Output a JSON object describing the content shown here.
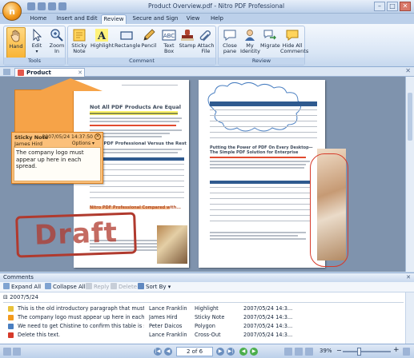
{
  "window": {
    "title": "Product Overview.pdf - Nitro PDF Professional",
    "controls": [
      "–",
      "□",
      "✕"
    ]
  },
  "ribbon_tabs": [
    {
      "label": "Home",
      "active": false
    },
    {
      "label": "Insert and Edit",
      "active": false
    },
    {
      "label": "Review",
      "active": true
    },
    {
      "label": "Secure and Sign",
      "active": false
    },
    {
      "label": "View",
      "active": false
    },
    {
      "label": "Help",
      "active": false
    }
  ],
  "ribbon": {
    "tools_group": "Tools",
    "comment_group": "Comment",
    "review_group": "Review",
    "buttons": {
      "hand": "Hand",
      "edit": "Edit",
      "zoom_in": "Zoom In",
      "sticky_note": "Sticky Note",
      "highlight": "Highlight",
      "rectangle": "Rectangle",
      "pencil": "Pencil",
      "text_box": "Text Box",
      "stamp": "Stamp",
      "attach_file": "Attach File",
      "close_pane": "Close pane",
      "my_identity": "My Identity",
      "migrate": "Migrate",
      "hide_all_comments": "Hide All Comments"
    }
  },
  "document_tab": {
    "label": "Product Overview.pdf"
  },
  "page_left": {
    "heading": "Not All PDF Products Are Equal",
    "subheading": "Nitro PDF Professional Versus the Rest",
    "subheading2": "Nitro PDF Professional Compared with..."
  },
  "page_right": {
    "heading": "Putting the Power of PDF On Every Desktop—The Simple PDF Solution for Enterprise"
  },
  "sticky_note": {
    "title": "Sticky Note",
    "date": "2007/05/24 14:37:50",
    "author": "James Hird",
    "options": "Options ▾",
    "text": "The company logo must appear up here in each spread."
  },
  "stamp": {
    "text": "Draft"
  },
  "comments": {
    "panel_title": "Comments",
    "toolbar": {
      "expand_all": "Expand All",
      "collapse_all": "Collapse All",
      "reply": "Reply",
      "delete": "Delete",
      "sort_by": "Sort By ▾"
    },
    "group_date": "2007/5/24",
    "rows": [
      {
        "text": "This is the old introductory paragraph that must be repl...",
        "author": "Lance Franklin",
        "type": "Highlight",
        "date": "2007/05/24 14:3...",
        "color": "#e8c23a",
        "selected": false
      },
      {
        "text": "The company logo must appear up here in each spre...",
        "author": "James Hird",
        "type": "Sticky Note",
        "date": "2007/05/24 14:3...",
        "color": "#f39a1d",
        "selected": false
      },
      {
        "text": "We need to get Chistine to confirm this table is still ac...",
        "author": "Peter Daicos",
        "type": "Polygon",
        "date": "2007/05/24 14:3...",
        "color": "#4a7fc1",
        "selected": false
      },
      {
        "text": "Delete this text.",
        "author": "Lance Franklin",
        "type": "Cross-Out",
        "date": "2007/05/24 14:3...",
        "color": "#d63a2a",
        "selected": false
      }
    ]
  },
  "status": {
    "page_indicator": "2 of 6",
    "zoom": "39%"
  }
}
